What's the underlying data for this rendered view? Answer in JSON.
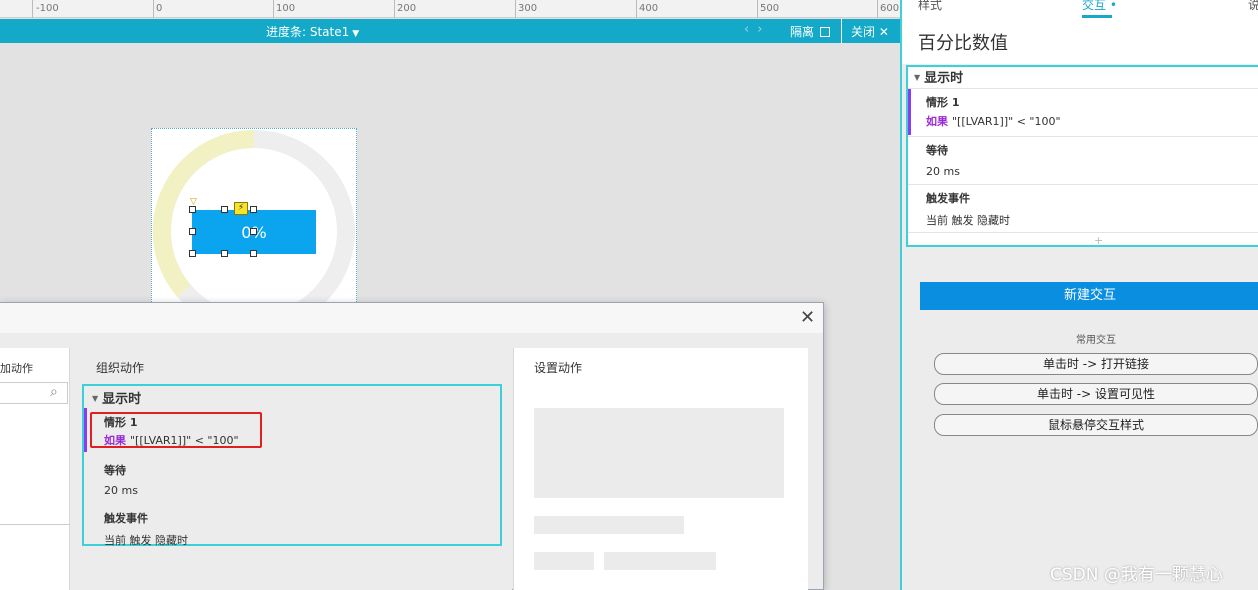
{
  "ruler": {
    "ticks": [
      "-100",
      "0",
      "100",
      "200",
      "300",
      "400",
      "500",
      "600"
    ]
  },
  "canvas_bar": {
    "state_title": "进度条: State1",
    "isolate_label": "隔离",
    "close_label": "关闭"
  },
  "widget": {
    "progress_text": "0%"
  },
  "dialog": {
    "left_header": "加动作",
    "organize_header": "组织动作",
    "settings_header": "设置动作",
    "event_name": "显示时",
    "case_name": "情形 1",
    "condition_keyword": "如果",
    "condition_text": "\"[[LVAR1]]\" < \"100\"",
    "wait_title": "等待",
    "wait_value": "20 ms",
    "fire_title": "触发事件",
    "fire_value": "当前 触发 隐藏时"
  },
  "right_panel": {
    "tab_style": "样式",
    "tab_interaction": "交互",
    "tab_extra": "说",
    "title": "百分比数值",
    "event_name": "显示时",
    "case_name": "情形 1",
    "condition_keyword": "如果",
    "condition_text": "\"[[LVAR1]]\" < \"100\"",
    "wait_title": "等待",
    "wait_value": "20 ms",
    "fire_title": "触发事件",
    "fire_value": "当前 触发 隐藏时",
    "new_interaction": "新建交互",
    "common_label": "常用交互",
    "quick_actions": [
      "单击时 -> 打开链接",
      "单击时 -> 设置可见性",
      "鼠标悬停交互样式"
    ]
  },
  "watermark": "CSDN @我有一颗慧心",
  "colors": {
    "accent": "#14a9c8",
    "progress_fill": "#0aa5ee",
    "condition_keyword": "#9a2bd6",
    "highlight_border": "#e0201c",
    "primary_button": "#0a8fe0"
  }
}
